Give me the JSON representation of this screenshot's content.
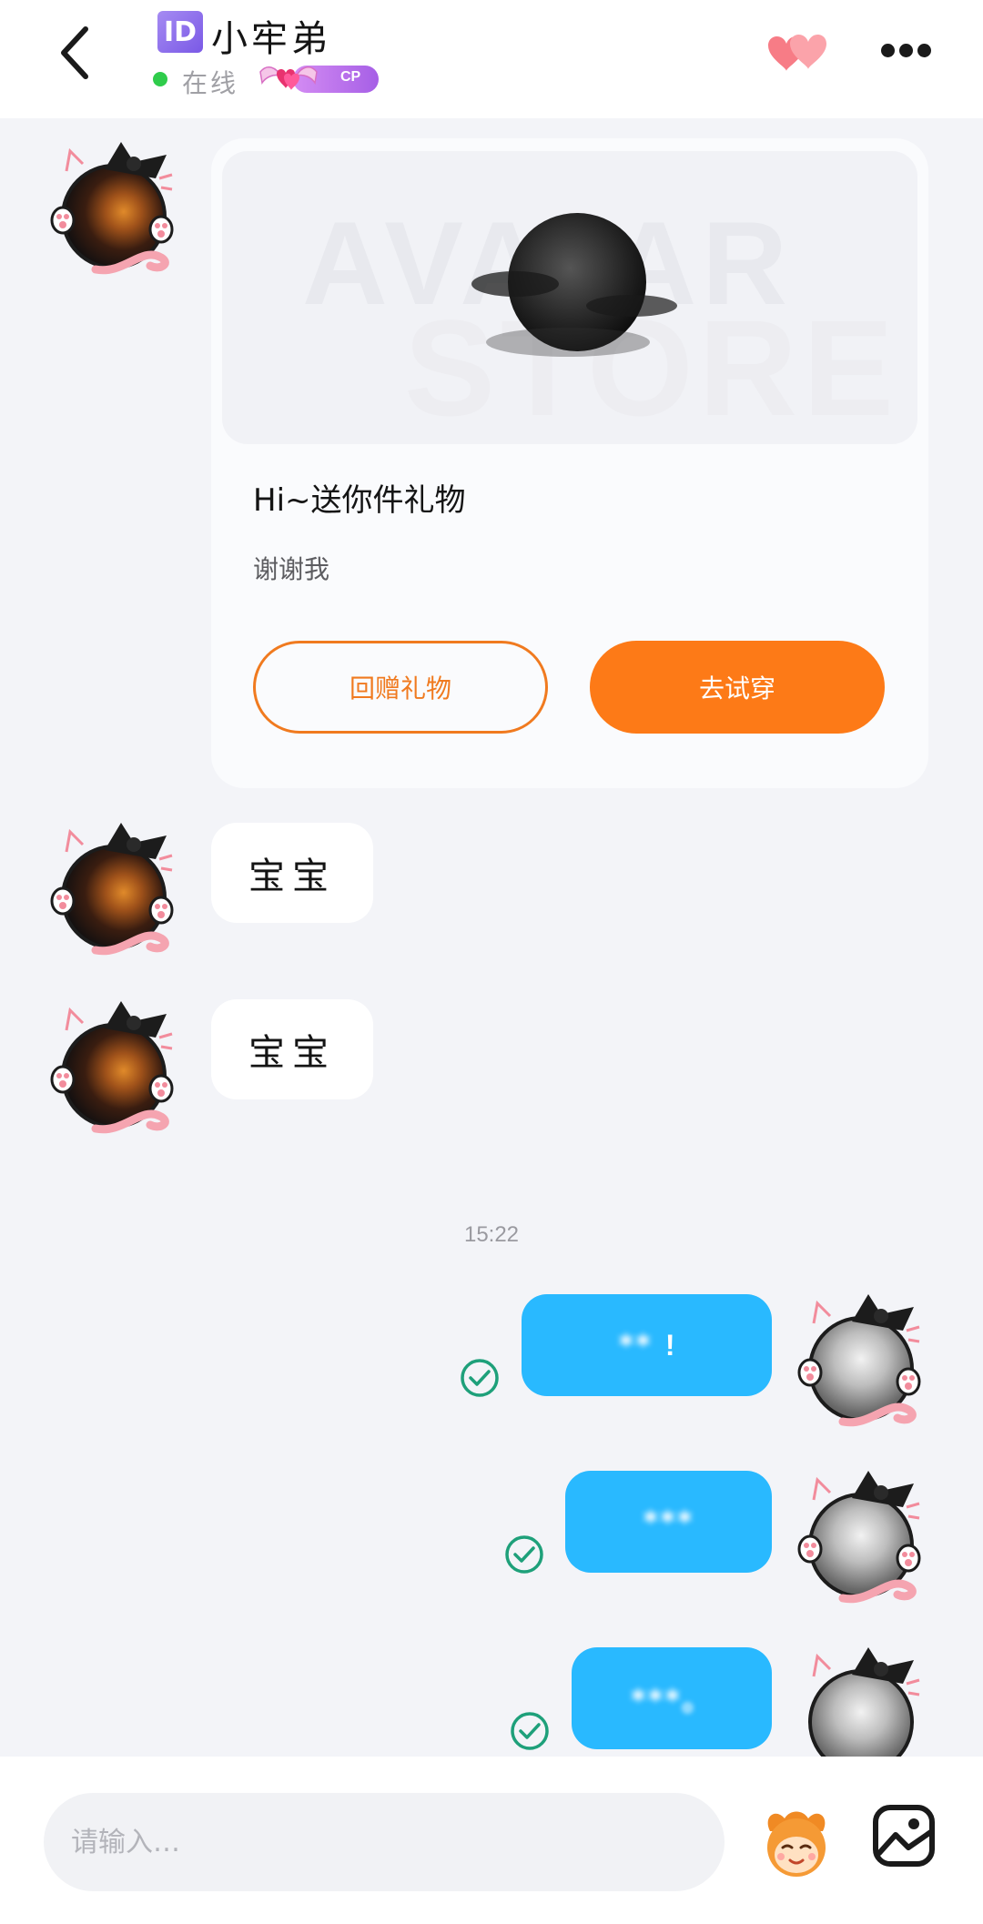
{
  "header": {
    "id_badge": "ID",
    "nickname": "小牢弟",
    "status": "在线",
    "cp_label": "CP",
    "icons": [
      "back-arrow-icon",
      "hearts-icon",
      "more-dots-icon",
      "id-badge-icon",
      "cp-badge-icon"
    ]
  },
  "gift_card": {
    "watermark_top": "AVATAR",
    "watermark_bottom": "STORE",
    "title": "Hi~送你件礼物",
    "subtitle": "谢谢我",
    "return_gift_label": "回赠礼物",
    "try_on_label": "去试穿"
  },
  "messages_in": [
    {
      "text": "宝宝"
    },
    {
      "text": "宝宝"
    }
  ],
  "timestamp": "15:22",
  "messages_out": [
    {
      "text": "**",
      "suffix": "!",
      "status": "sent-check-icon"
    },
    {
      "text": "***",
      "status": "sent-check-icon"
    },
    {
      "text": "***。",
      "status": "sent-check-icon"
    }
  ],
  "composer": {
    "placeholder": "请输入…",
    "icons": [
      "emoji-mascot-icon",
      "image-icon"
    ]
  },
  "colors": {
    "accent_orange": "#fd7a17",
    "outgoing_bubble": "#29b9ff",
    "online_green": "#2fcc4b",
    "check_green": "#1ea07a",
    "background": "#f3f4f8"
  }
}
